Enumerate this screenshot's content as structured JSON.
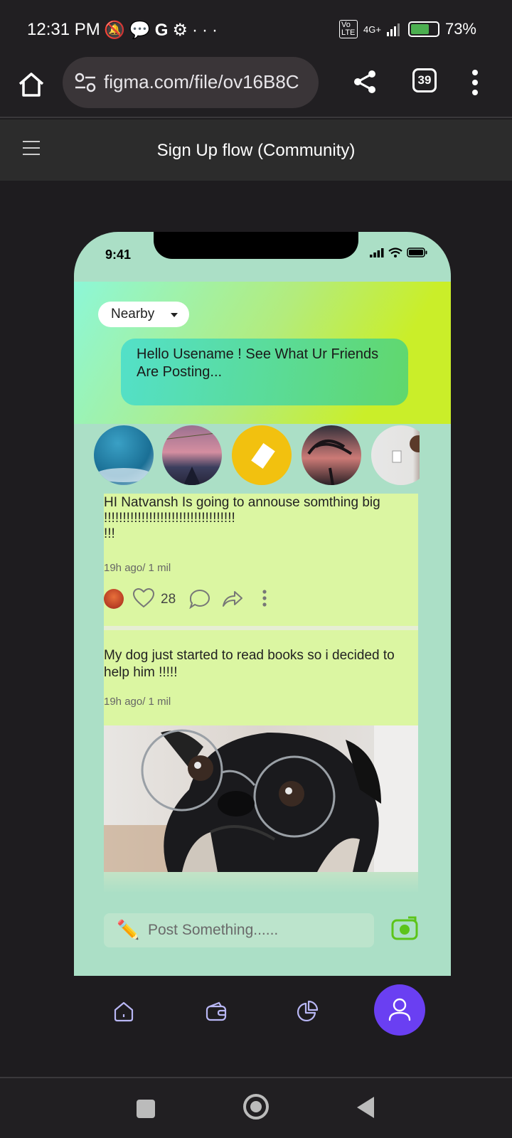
{
  "status_bar": {
    "time": "12:31 PM",
    "indicator_icons": [
      "mute-icon",
      "chat-icon",
      "g-icon",
      "settings-icon",
      "more-dots-icon"
    ],
    "network": "4G+",
    "volte": "Vo LTE",
    "battery": "73%",
    "battery_level": 0.73
  },
  "browser": {
    "url": "figma.com/file/ov16B8C",
    "tab_count": "39"
  },
  "figma": {
    "title": "Sign Up flow (Community)"
  },
  "phone": {
    "time": "9:41",
    "filter_label": "Nearby",
    "greeting": "Hello Usename ! See What Ur Friends Are Posting...",
    "stories": [
      "story-ocean",
      "story-sunset",
      "story-yellow",
      "story-palms",
      "story-room"
    ],
    "posts": [
      {
        "text": "HI Natvansh Is going to annouse somthing big\n!!!!!!!!!!!!!!!!!!!!!!!!!!!!!!!!!!!\n!!!",
        "meta": "19h ago/ 1 mil",
        "likes": "28"
      },
      {
        "text": "My dog just started to read books so i decided to help him !!!!!",
        "meta": "19h ago/ 1 mil"
      }
    ],
    "composer_placeholder": "Post Something......",
    "composer_icon": "✏️"
  },
  "colors": {
    "screen_bg": "#abdfc6",
    "post_bg": "#dbf6a2",
    "accent": "#6a3ff2",
    "camera": "#5cc419"
  }
}
